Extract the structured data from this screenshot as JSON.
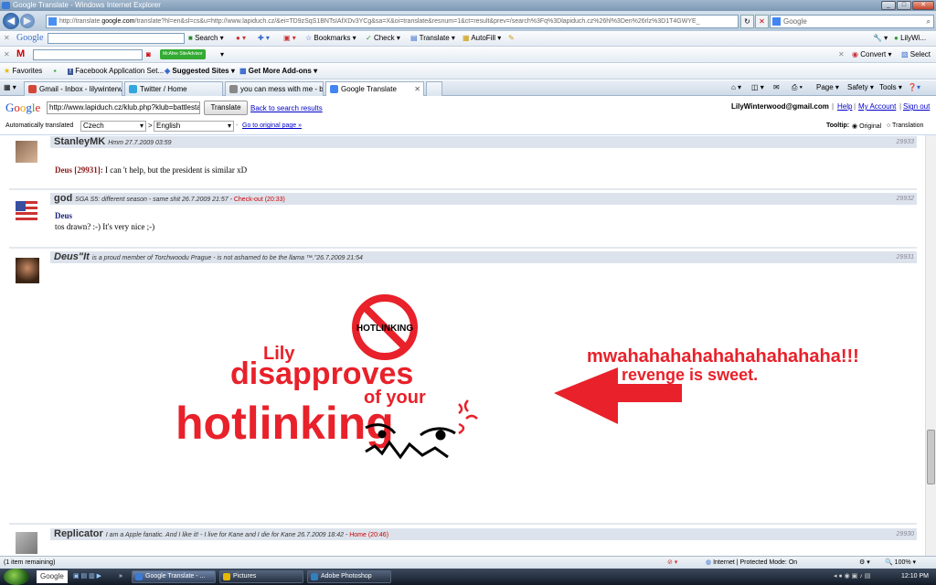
{
  "window": {
    "title": "Google Translate - Windows Internet Explorer"
  },
  "address": {
    "url_prefix": "http://translate.",
    "url_domain": "google.com",
    "url_rest": "/translate?hl=en&sl=cs&u=http://www.lapiduch.cz/&ei=TD9zSqS1BNTsIAfXDv3YCg&sa=X&oi=translate&resnum=1&ct=result&prev=/search%3Fq%3Dlapiduch.cz%26hl%3Den%26rlz%3D1T4GWYE_",
    "search_placeholder": "Google"
  },
  "google_toolbar": {
    "logo": "Google",
    "search_label": "Search",
    "bookmarks_label": "Bookmarks",
    "check_label": "Check",
    "translate_label": "Translate",
    "autofill_label": "AutoFill",
    "user_label": "LilyWi..."
  },
  "mail_toolbar": {
    "logo": "M",
    "siteadvisor_label": "McAfee SiteAdvisor",
    "convert_label": "Convert",
    "select_label": "Select"
  },
  "favorites_bar": {
    "favorites_label": "Favorites",
    "facebook_label": "Facebook  Application Set...",
    "suggested_label": "Suggested Sites",
    "addons_label": "Get More Add-ons"
  },
  "tabs": [
    {
      "label": "Gmail - Inbox - lilywinterw...",
      "color": "#d44638"
    },
    {
      "label": "Twitter / Home",
      "color": "#33a6dd"
    },
    {
      "label": "you can mess with me - b...",
      "color": "#888888"
    },
    {
      "label": "Google Translate",
      "color": "#4285f4"
    }
  ],
  "commands": {
    "page": "Page",
    "safety": "Safety",
    "tools": "Tools"
  },
  "translate_bar": {
    "url": "http://www.lapiduch.cz/klub.php?klub=battlesta",
    "translate_button": "Translate",
    "back_link": "Back to search results",
    "account_email": "LilyWinterwood@gmail.com",
    "help_link": "Help",
    "my_account_link": "My Account",
    "sign_out_link": "Sign out",
    "auto_label": "Automatically translated",
    "from_lang": "Czech",
    "arrow": ">",
    "to_lang": "English",
    "original_link": "Go to original page »",
    "tooltip_label": "Tooltip:",
    "original_option": "Original",
    "translation_option": "Translation"
  },
  "posts": [
    {
      "name": "StanleyMK",
      "meta": "Hmm 27.7.2009 03:59",
      "red": "",
      "number": "29933",
      "quote": "Deus [29931]:",
      "text": "I can 't help, but the president is similar xD"
    },
    {
      "name": "god",
      "meta": "SGA S5: different season - same shit 26.7.2009 21:57 -",
      "red": "Check-out (20:33)",
      "number": "29932",
      "quote": "Deus",
      "text": "tos drawn?  :-) It's very nice ;-)"
    },
    {
      "name": "Deus\"It",
      "meta": "is a proud member of Torchwoodu Prague - is not ashamed to be the llama ™.\"26.7.2009 21:54",
      "red": "",
      "number": "29931"
    },
    {
      "name": "Replicator",
      "meta": "I am a Apple fanatic.  And I like it!  - I live for Kane and I die for Kane 26.7.2009 18:42 -",
      "red": "Home (20:46)",
      "number": "29930"
    }
  ],
  "hotlink_image": {
    "sign_text": "HOTLINKING",
    "lily": "Lily",
    "disapproves": "disapproves",
    "of_your": "of your",
    "hotlinking": "hotlinking",
    "mwah": "mwahahahahahahahahahaha!!!",
    "revenge": "revenge is sweet.",
    "red": "#e8212a"
  },
  "statusbar": {
    "left": "(1 item remaining)",
    "zone": "Internet | Protected Mode: On",
    "zoom": "100%"
  },
  "taskbar": {
    "google_label": "Google",
    "buttons": [
      "Google Translate - ...",
      "Pictures",
      "Adobe Photoshop"
    ],
    "time": "12:10 PM"
  }
}
